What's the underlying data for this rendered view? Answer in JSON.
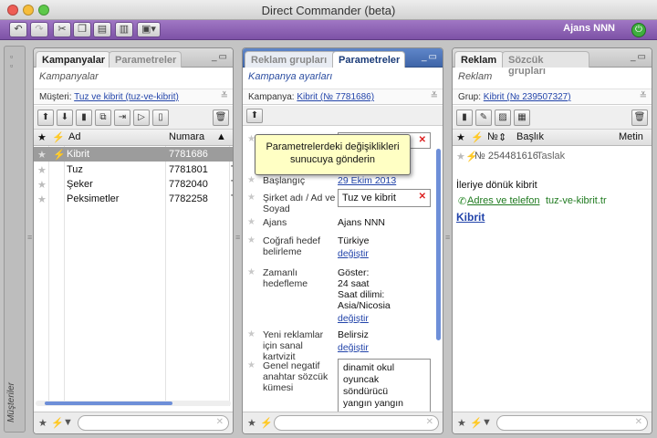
{
  "window": {
    "title": "Direct Commander (beta)"
  },
  "toolbar": {
    "account": "Ajans NNN"
  },
  "sidebar": {
    "label": "Müşteriler"
  },
  "campaigns": {
    "tabs": [
      "Kampanyalar",
      "Parametreler"
    ],
    "subtitle": "Kampanyalar",
    "filter_label": "Müşteri:",
    "filter_value": "Tuz ve kibrit (tuz-ve-kibrit)",
    "columns": [
      "Ad",
      "Numara"
    ],
    "rows": [
      {
        "name": "Kibrit",
        "number": "7781686"
      },
      {
        "name": "Tuz",
        "number": "7781801"
      },
      {
        "name": "Şeker",
        "number": "7782040"
      },
      {
        "name": "Peksimetler",
        "number": "7782258"
      }
    ],
    "row_tail": [
      "T",
      "T",
      "T"
    ]
  },
  "groups": {
    "tabs": [
      "Reklam grupları",
      "Parametreler"
    ],
    "subtitle": "Kampanya ayarları",
    "filter_label": "Kampanya:",
    "filter_value": "Kibrit (№ 7781686)",
    "params": {
      "start_label": "Başlangıç",
      "start_value": "29 Ekim 2013",
      "company_label": "Şirket adı / Ad ve Soyad",
      "company_value": "Tuz ve kibrit",
      "agency_label": "Ajans",
      "agency_value": "Ajans NNN",
      "geo_label": "Coğrafi hedef belirleme",
      "geo_value": "Türkiye",
      "change": "değiştir",
      "time_label": "Zamanlı hedefleme",
      "time_lines": [
        "Göster:",
        "24 saat",
        "Saat dilimi:",
        "Asia/Nicosia"
      ],
      "vcard_label": "Yeni reklamlar için sanal kartvizit",
      "vcard_value": "Belirsiz",
      "negative_label": "Genel negatif anahtar sözcük kümesi",
      "negative_lines": [
        "dinamit okul",
        "oyuncak söndürücü",
        "yangın yangın"
      ]
    },
    "tooltip": "Parametrelerdeki değişiklikleri sunucuya gönderin"
  },
  "ads": {
    "tabs": [
      "Reklam",
      "Sözcük grupları"
    ],
    "subtitle": "Reklam",
    "filter_label": "Grup:",
    "filter_value": "Kibrit (№ 239507327)",
    "columns": [
      "№",
      "Başlık",
      "Metin"
    ],
    "ad": {
      "id": "№ 254481616",
      "status": "Taslak",
      "title": "Kibrit",
      "text": "İleriye dönük kibrit",
      "contact": "Adres ve telefon",
      "domain": "tuz-ve-kibrit.tr"
    }
  },
  "colors": {
    "accent": "#8a5fb4",
    "link": "#2244aa",
    "tab_blue": "#4a70b4"
  }
}
